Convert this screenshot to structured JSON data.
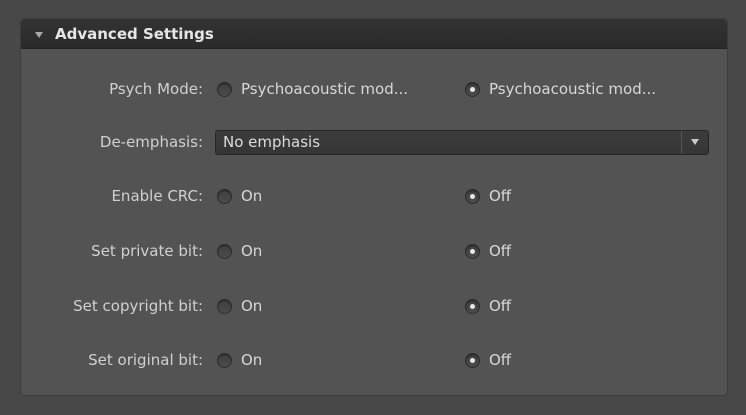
{
  "panel": {
    "title": "Advanced Settings"
  },
  "settings": {
    "psych_mode": {
      "label": "Psych Mode:",
      "options": [
        "Psychoacoustic mod...",
        "Psychoacoustic mod..."
      ],
      "selected_index": 1
    },
    "de_emphasis": {
      "label": "De-emphasis:",
      "value": "No emphasis"
    },
    "enable_crc": {
      "label": "Enable CRC:",
      "options": [
        "On",
        "Off"
      ],
      "selected_index": 1
    },
    "private_bit": {
      "label": "Set private bit:",
      "options": [
        "On",
        "Off"
      ],
      "selected_index": 1
    },
    "copyright_bit": {
      "label": "Set copyright bit:",
      "options": [
        "On",
        "Off"
      ],
      "selected_index": 1
    },
    "original_bit": {
      "label": "Set original bit:",
      "options": [
        "On",
        "Off"
      ],
      "selected_index": 1
    }
  },
  "icons": {
    "collapse": "triangle-down-icon",
    "dropdown": "chevron-down-icon"
  }
}
